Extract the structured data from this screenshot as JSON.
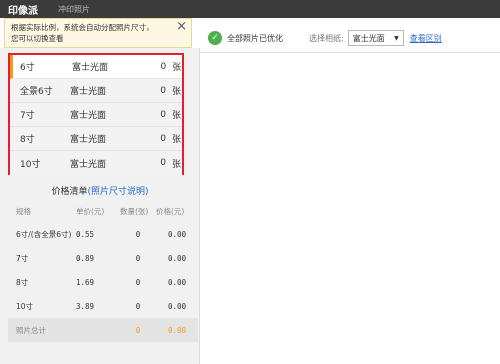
{
  "header": {
    "app_name": "印像派",
    "tab_label": "冲印照片"
  },
  "tooltip": {
    "line1": "根据实际比例，系统会自动分配照片尺寸，",
    "line2": "您可以切换查看",
    "close_icon": "×"
  },
  "toolbar": {
    "check_icon": "✓",
    "status_text": "全部照片已优化",
    "paper_label": "选择相纸:",
    "paper_value": "富士光面",
    "view_diff": "查看区别",
    "accent_green": "#4cae4c"
  },
  "sizes": [
    {
      "name": "6寸",
      "paper": "富士光面",
      "count": "0",
      "unit": "张"
    },
    {
      "name": "全景6寸",
      "paper": "富士光面",
      "count": "0",
      "unit": "张"
    },
    {
      "name": "7寸",
      "paper": "富士光面",
      "count": "0",
      "unit": "张"
    },
    {
      "name": "8寸",
      "paper": "富士光面",
      "count": "0",
      "unit": "张"
    },
    {
      "name": "10寸",
      "paper": "富士光面",
      "count": "0",
      "unit": "张"
    }
  ],
  "price_list": {
    "title": "价格清单",
    "link": "(照片尺寸说明)",
    "headers": [
      "规格",
      "单价(元)",
      "数量(张)",
      "价格(元)"
    ],
    "rows": [
      [
        "6寸/(含全景6寸)",
        "0.55",
        "0",
        "0.00"
      ],
      [
        "7寸",
        "0.89",
        "0",
        "0.00"
      ],
      [
        "8寸",
        "1.69",
        "0",
        "0.00"
      ],
      [
        "10寸",
        "3.89",
        "0",
        "0.00"
      ]
    ],
    "total": {
      "label": "照片总计",
      "qty": "0",
      "price": "0.00"
    }
  },
  "colors": {
    "highlight_border": "#e0202a",
    "active_marker": "#f39a1e",
    "link": "#2a6ac8"
  }
}
